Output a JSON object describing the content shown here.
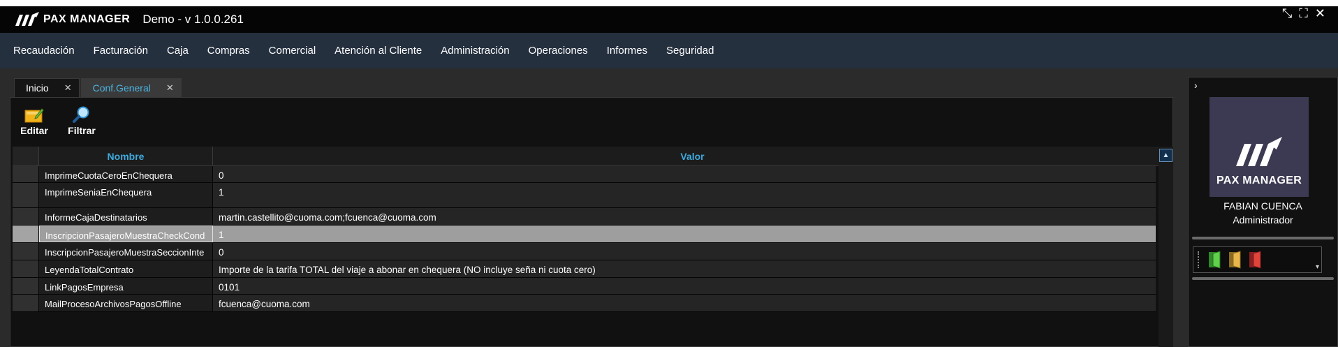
{
  "app": {
    "brand": "PAX MANAGER",
    "title": "Demo - v 1.0.0.261"
  },
  "window_controls": [
    "restore-icon",
    "maximize-icon",
    "close-icon"
  ],
  "menu": [
    "Recaudación",
    "Facturación",
    "Caja",
    "Compras",
    "Comercial",
    "Atención al Cliente",
    "Administración",
    "Operaciones",
    "Informes",
    "Seguridad"
  ],
  "tabs": [
    {
      "label": "Inicio",
      "active": false
    },
    {
      "label": "Conf.General",
      "active": true
    }
  ],
  "toolbar": {
    "edit_label": "Editar",
    "filter_label": "Filtrar"
  },
  "grid": {
    "columns": {
      "nombre": "Nombre",
      "valor": "Valor"
    },
    "rows": [
      {
        "nombre": "ImprimeCuotaCeroEnChequera",
        "valor": "0"
      },
      {
        "nombre": "ImprimeSeniaEnChequera",
        "valor": "1"
      },
      {
        "nombre": "InformeCajaDestinatarios",
        "valor": "martin.castellito@cuoma.com;fcuenca@cuoma.com"
      },
      {
        "nombre": "InscripcionPasajeroMuestraCheckCond",
        "valor": "1"
      },
      {
        "nombre": "InscripcionPasajeroMuestraSeccionInte",
        "valor": "0"
      },
      {
        "nombre": "LeyendaTotalContrato",
        "valor": "Importe de la tarifa TOTAL del viaje a abonar en chequera (NO incluye seña ni cuota cero)"
      },
      {
        "nombre": "LinkPagosEmpresa",
        "valor": "0101"
      },
      {
        "nombre": "MailProcesoArchivosPagosOffline",
        "valor": "fcuenca@cuoma.com"
      }
    ],
    "selected_row": 3
  },
  "user_panel": {
    "brand": "PAX MANAGER",
    "name": "FABIAN CUENCA",
    "role": "Administrador"
  },
  "quick_access": [
    "door-green-icon",
    "door-yellow-icon",
    "door-red-icon"
  ],
  "colors": {
    "menubar": "#25303f",
    "header_text": "#3fa9dc",
    "active_tab_text": "#4bb3e0",
    "avatar_bg": "#3c3a52",
    "selected_row": "#9e9e9e"
  }
}
